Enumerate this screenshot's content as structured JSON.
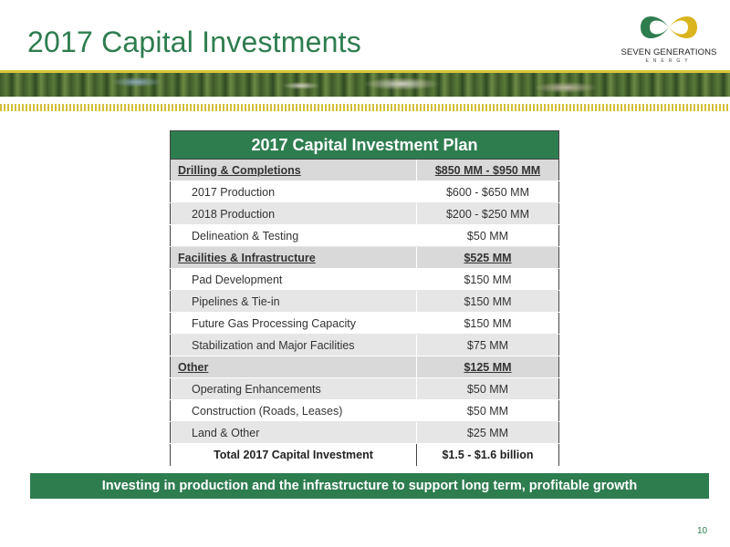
{
  "slide": {
    "title": "2017 Capital Investments",
    "page_number": "10",
    "banner": "Investing in production and the infrastructure to support long term, profitable growth"
  },
  "logo": {
    "name": "SEVEN GENERATIONS",
    "sub": "ENERGY"
  },
  "table": {
    "header": "2017 Capital Investment Plan",
    "rows": [
      {
        "label": "Drilling & Completions",
        "value": "$850 MM - $950 MM"
      },
      {
        "label": "2017 Production",
        "value": "$600 - $650 MM"
      },
      {
        "label": "2018 Production",
        "value": "$200 - $250 MM"
      },
      {
        "label": "Delineation & Testing",
        "value": "$50 MM"
      },
      {
        "label": "Facilities & Infrastructure",
        "value": "$525 MM"
      },
      {
        "label": "Pad Development",
        "value": "$150 MM"
      },
      {
        "label": "Pipelines & Tie-in",
        "value": "$150 MM"
      },
      {
        "label": "Future Gas Processing Capacity",
        "value": "$150 MM"
      },
      {
        "label": "Stabilization and Major Facilities",
        "value": "$75 MM"
      },
      {
        "label": "Other",
        "value": "$125 MM"
      },
      {
        "label": "Operating Enhancements",
        "value": "$50 MM"
      },
      {
        "label": "Construction (Roads, Leases)",
        "value": "$50 MM"
      },
      {
        "label": "Land & Other",
        "value": "$25 MM"
      }
    ],
    "total": {
      "label": "Total 2017 Capital Investment",
      "value": "$1.5 - $1.6 billion"
    }
  },
  "colors": {
    "brand_green": "#2e7d4f",
    "accent_yellow": "#d9c63b"
  }
}
